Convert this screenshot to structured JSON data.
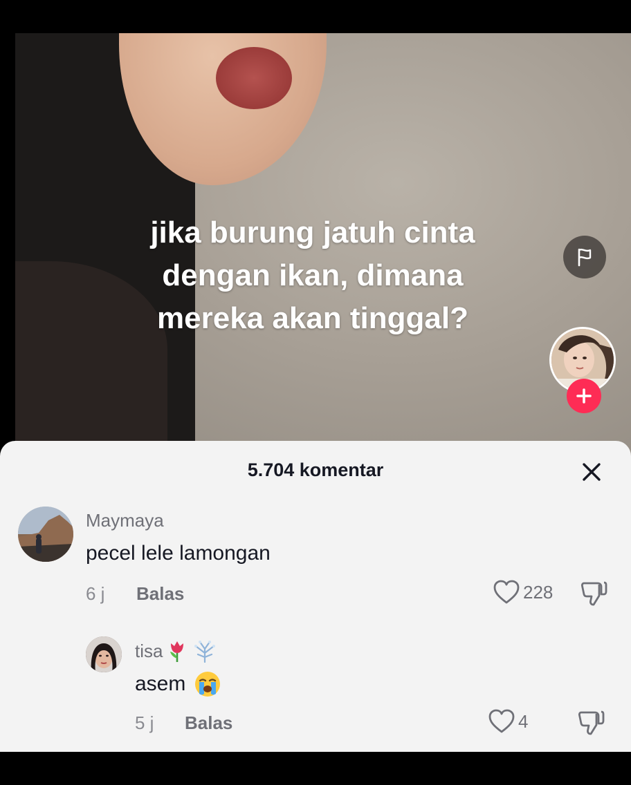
{
  "video": {
    "overlay_lines": [
      "jika burung jatuh cinta",
      "dengan ikan, dimana",
      "mereka akan tinggal?"
    ]
  },
  "comments_sheet": {
    "title": "5.704 komentar",
    "comments": [
      {
        "username": "Maymaya",
        "text": "pecel lele lamongan",
        "time": "6 j",
        "reply_label": "Balas",
        "likes": "228"
      },
      {
        "username": "tisa",
        "username_emoji": [
          "tulip-emoji",
          "sparkle-emoji"
        ],
        "text": "asem",
        "text_emoji": "loudly-crying-face-emoji",
        "time": "5 j",
        "reply_label": "Balas",
        "likes": "4"
      }
    ]
  },
  "colors": {
    "follow_accent": "#fe2c55",
    "sheet_background": "#f3f3f3",
    "primary_text": "#161823",
    "secondary_text": "#6f7077"
  }
}
